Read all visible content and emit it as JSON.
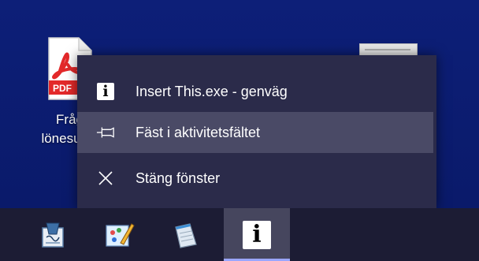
{
  "desktop": {
    "pdf_icon": {
      "badge": "PDF",
      "label_line1": "Fråg",
      "label_line2": "lönesup"
    }
  },
  "menu": {
    "items": [
      {
        "label": "Insert This.exe - genväg",
        "icon": "insert-this-app-icon"
      },
      {
        "label": "Fäst i aktivitetsfältet",
        "icon": "pin-icon"
      },
      {
        "label": "Stäng fönster",
        "icon": "close-icon"
      }
    ],
    "app_glyph": "i"
  },
  "taskbar": {
    "items": [
      {
        "icon": "document-signature-icon"
      },
      {
        "icon": "paint-app-icon"
      },
      {
        "icon": "notepad-icon"
      },
      {
        "icon": "insert-this-app-icon",
        "glyph": "i",
        "active": true
      }
    ]
  },
  "colors": {
    "desktop": "#0c1c6e",
    "menu_bg": "#2b2b4a",
    "menu_hover": "#4a4a66",
    "taskbar": "#1c1c34",
    "taskbar_active": "#46465e",
    "pdf_red": "#e3292a"
  }
}
